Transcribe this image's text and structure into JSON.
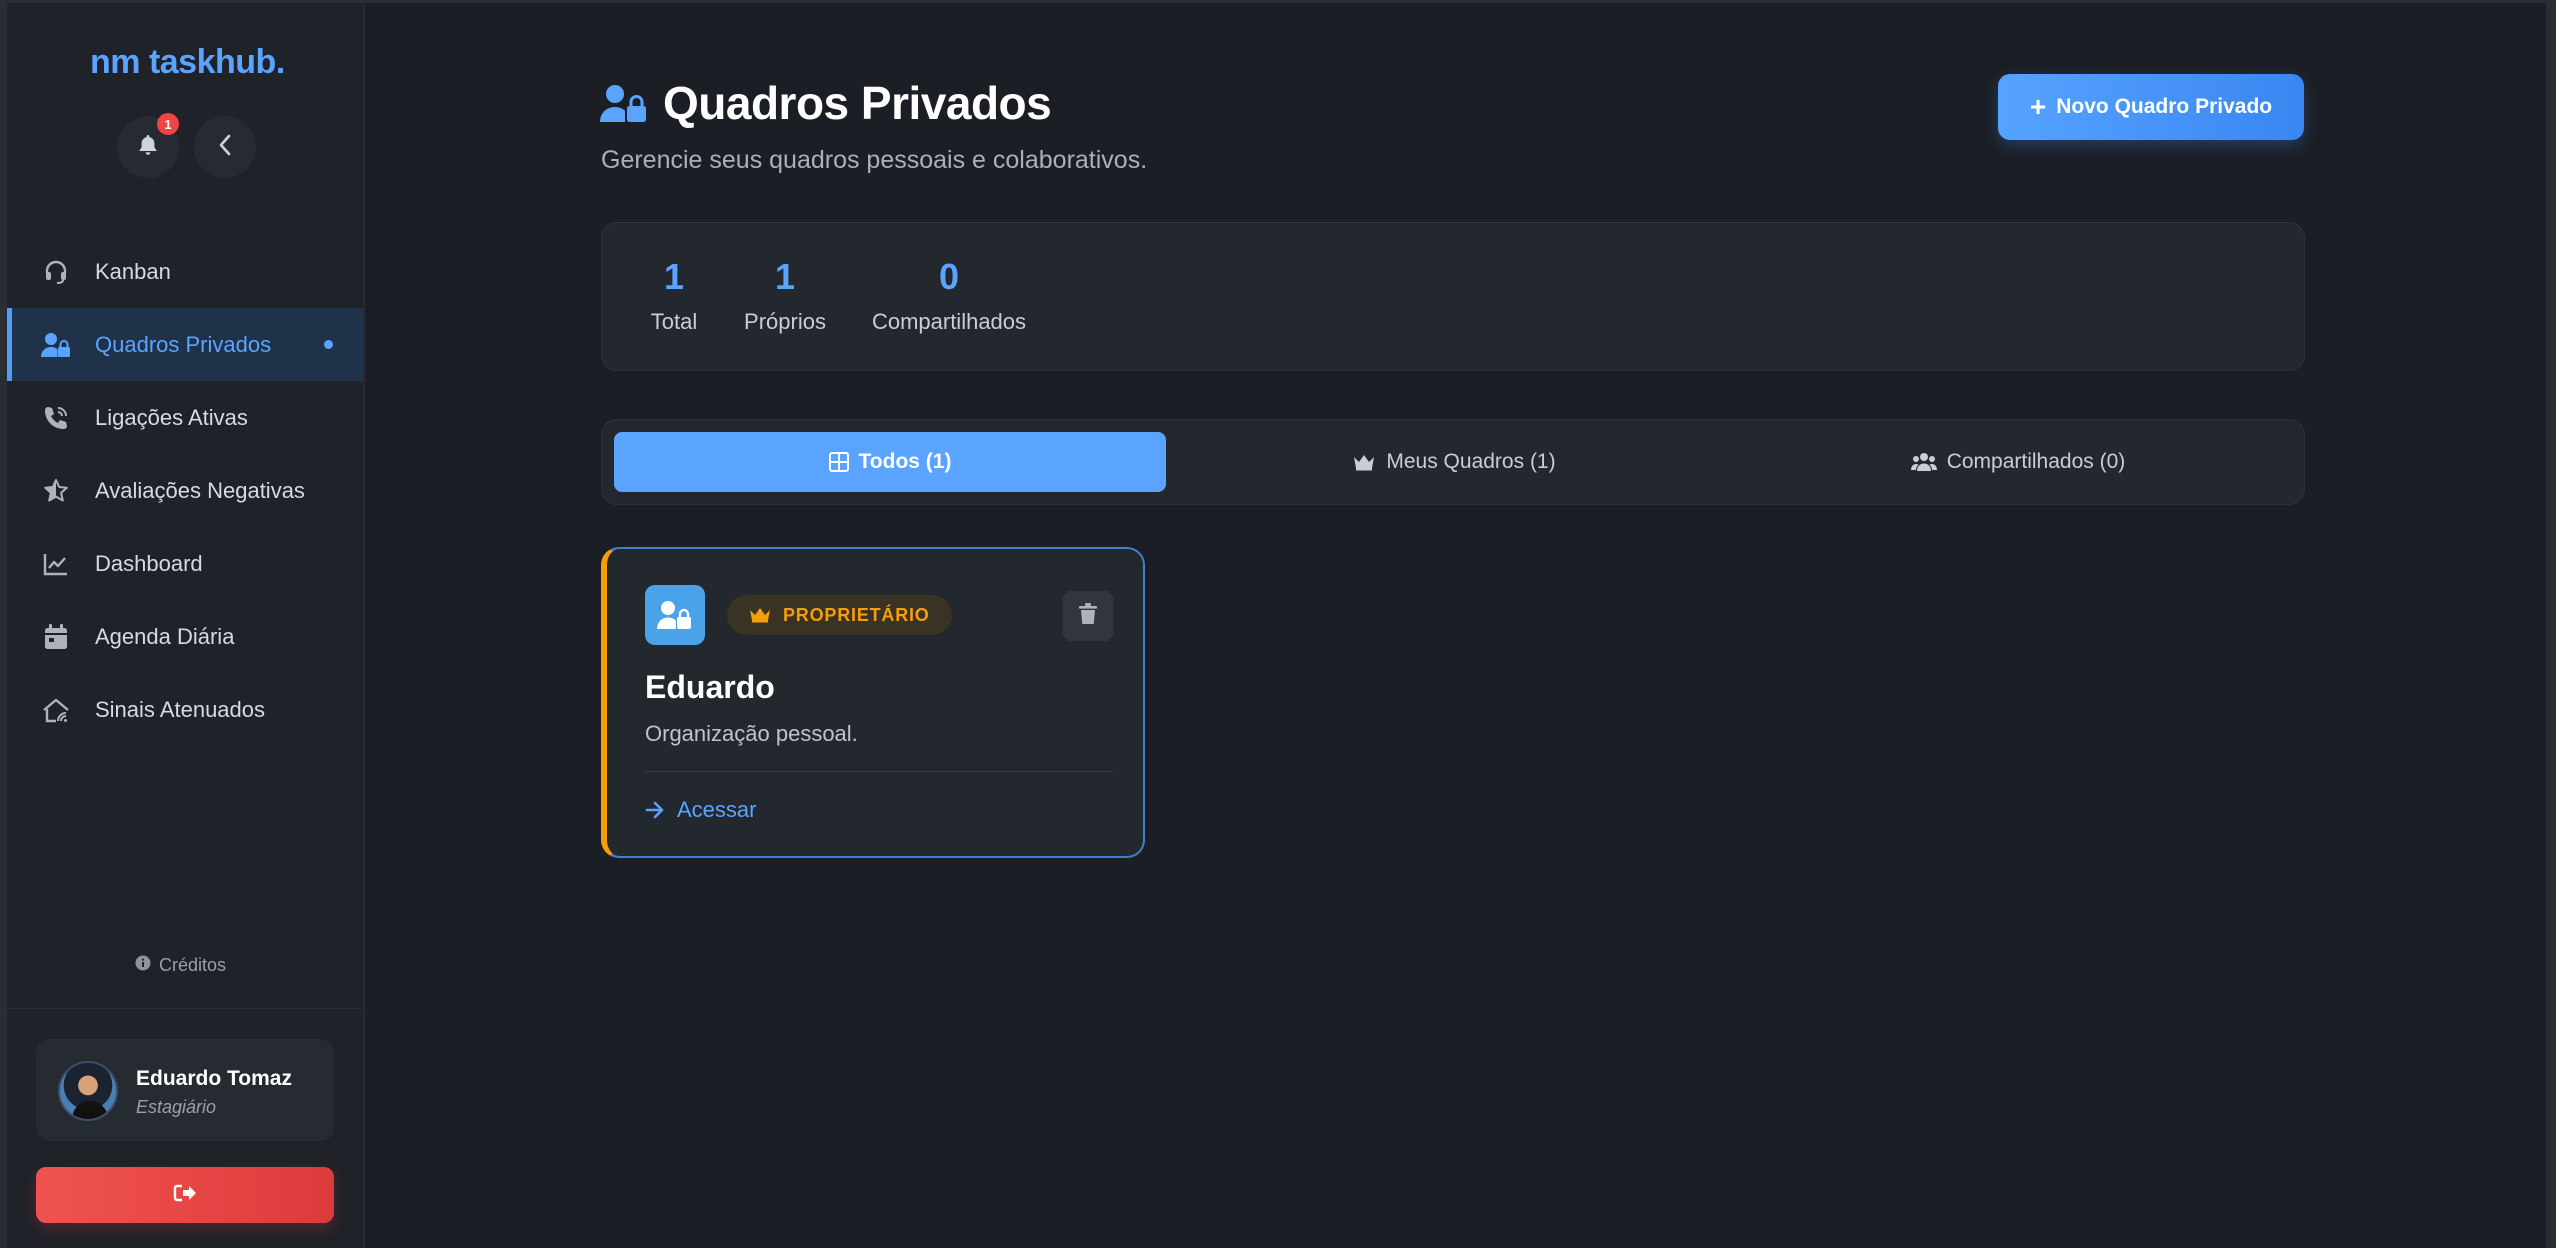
{
  "app": {
    "logo": "nm taskhub",
    "logo_dot": "."
  },
  "notifications": {
    "count": "1"
  },
  "sidebar": {
    "items": [
      {
        "label": "Kanban",
        "icon": "headset-icon"
      },
      {
        "label": "Quadros Privados",
        "icon": "user-lock-icon",
        "active": true
      },
      {
        "label": "Ligações Ativas",
        "icon": "phone-volume-icon"
      },
      {
        "label": "Avaliações Negativas",
        "icon": "star-half-icon"
      },
      {
        "label": "Dashboard",
        "icon": "chart-line-icon"
      },
      {
        "label": "Agenda Diária",
        "icon": "calendar-icon"
      },
      {
        "label": "Sinais Atenuados",
        "icon": "signal-house-icon"
      }
    ],
    "credits": "Créditos"
  },
  "user": {
    "name": "Eduardo Tomaz",
    "role": "Estagiário"
  },
  "header": {
    "title": "Quadros Privados",
    "subtitle": "Gerencie seus quadros pessoais e colaborativos.",
    "new_button": "Novo Quadro Privado"
  },
  "stats": [
    {
      "value": "1",
      "label": "Total"
    },
    {
      "value": "1",
      "label": "Próprios"
    },
    {
      "value": "0",
      "label": "Compartilhados"
    }
  ],
  "tabs": [
    {
      "label": "Todos (1)",
      "icon": "grid-icon",
      "active": true
    },
    {
      "label": "Meus Quadros (1)",
      "icon": "crown-icon"
    },
    {
      "label": "Compartilhados (0)",
      "icon": "users-icon"
    }
  ],
  "boards": [
    {
      "badge": "PROPRIETÁRIO",
      "title": "Eduardo",
      "description": "Organização pessoal.",
      "link": "Acessar"
    }
  ],
  "colors": {
    "accent": "#5aa4ff",
    "owner": "#f59e0b",
    "danger": "#ef4444",
    "background": "#1b1e24",
    "sidebar": "#1f2229"
  }
}
